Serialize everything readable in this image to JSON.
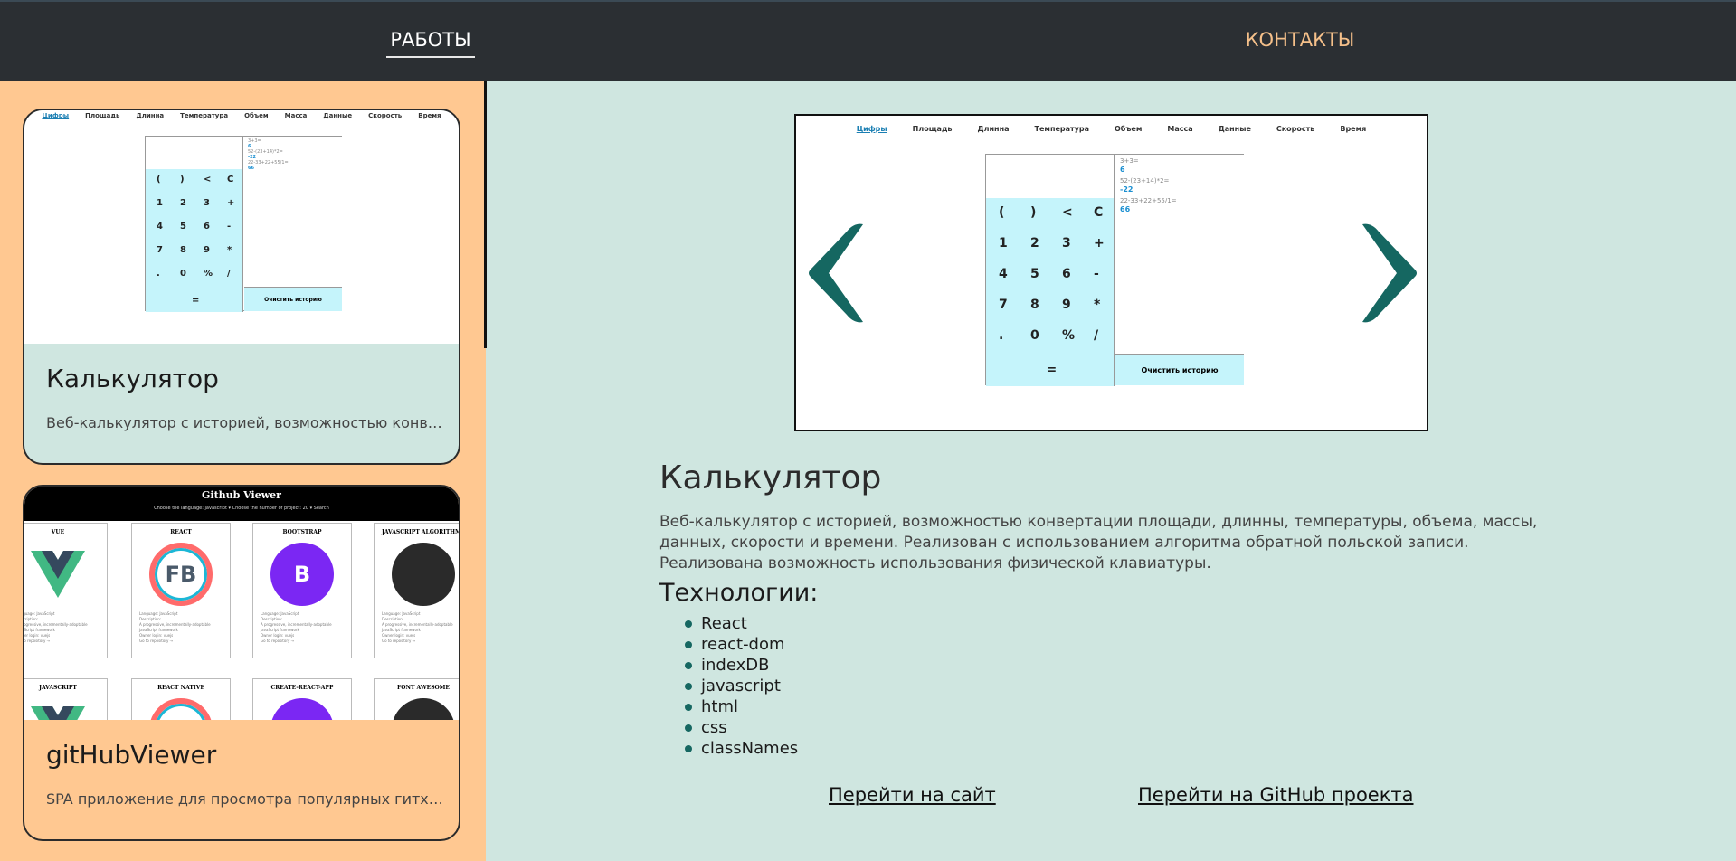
{
  "nav": {
    "works": "РАБОТЫ",
    "contacts": "КОНТАКТЫ"
  },
  "calc_thumb": {
    "menu": [
      "Цифры",
      "Площадь",
      "Длинна",
      "Температура",
      "Объем",
      "Масса",
      "Данные",
      "Скорость",
      "Время"
    ],
    "keys": [
      [
        "(",
        ")",
        "<",
        "C"
      ],
      [
        "1",
        "2",
        "3",
        "+"
      ],
      [
        "4",
        "5",
        "6",
        "-"
      ],
      [
        "7",
        "8",
        "9",
        "*"
      ],
      [
        ".",
        "0",
        "%",
        "/"
      ]
    ],
    "equals": "=",
    "clear_history": "Очистить историю",
    "history": [
      {
        "expr": "3+3=",
        "result": "6"
      },
      {
        "expr": "52-(23+14)*2=",
        "result": "-22"
      },
      {
        "expr": "22-33+22+55/1=",
        "result": "66"
      }
    ]
  },
  "github_thumb": {
    "title": "Github Viewer",
    "controls": "Choose the language: javascript ▾    Choose the number of project: 20 ▾    Search",
    "cards": [
      "VUE",
      "REACT",
      "BOOTSTRAP",
      "JAVASCRIPT ALGORITHMS",
      "JAVASCRIPT",
      "REACT NATIVE",
      "CREATE-REACT-APP",
      "FONT AWESOME"
    ],
    "card_lines": [
      "Language: JavaScript",
      "Description:",
      "A progressive, incrementally-adoptable JavaScript framework",
      "Owner login: vuejs",
      "Go to repository →"
    ],
    "logos": [
      "V",
      "FB",
      "B",
      ""
    ]
  },
  "cards": [
    {
      "title": "Калькулятор",
      "desc": "Веб-калькулятор с историей, возможностью конвертации площади, длинны, температуры, объема, массы, данных, скорости и времени."
    },
    {
      "title": "gitHubViewer",
      "desc": "SPA приложение для просмотра популярных гитхаб репозиториев."
    }
  ],
  "project": {
    "title": "Калькулятор",
    "description": "Веб-калькулятор с историей, возможностью конвертации площади, длинны, температуры, объема, массы, данных, скорости и времени. Реализован с использованием алгоритма обратной польской записи. Реализована возможность использования физической клавиатуры.",
    "tech_title": "Технологии:",
    "technologies": [
      "React",
      "react-dom",
      "indexDB",
      "javascript",
      "html",
      "css",
      "classNames"
    ],
    "link_site": "Перейти на сайт",
    "link_github": "Перейти на GitHub проекта"
  },
  "icons": {
    "prev": "chevron-left-icon",
    "next": "chevron-right-icon"
  },
  "colors": {
    "nav_bg": "#2b2f33",
    "sidebar_bg": "#ffc891",
    "main_bg": "#cfe6e0",
    "accent": "#156761",
    "contacts": "#f5c08a"
  }
}
